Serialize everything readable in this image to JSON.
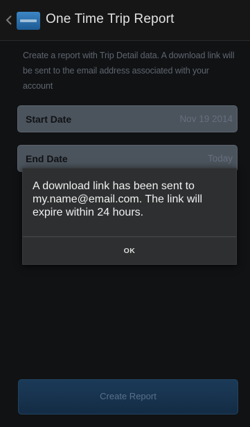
{
  "header": {
    "title": "One Time Trip Report",
    "back_icon": "chevron-left-icon",
    "app_icon": "app-logo-icon"
  },
  "main": {
    "description": "Create a report with Trip Detail data. A download link will be sent to the email address associated with your account",
    "start_date": {
      "label": "Start Date",
      "value": "Nov 19 2014"
    },
    "end_date": {
      "label": "End Date",
      "value": "Today"
    },
    "create_button": "Create Report"
  },
  "dialog": {
    "message": "A download link has been sent to my.name@email.com. The link will expire within 24 hours.",
    "ok_label": "OK"
  },
  "colors": {
    "background": "#0b0b0c",
    "field_background": "#4b535c",
    "primary_button": "#1b3a58",
    "dialog_background": "#2e2f30"
  }
}
